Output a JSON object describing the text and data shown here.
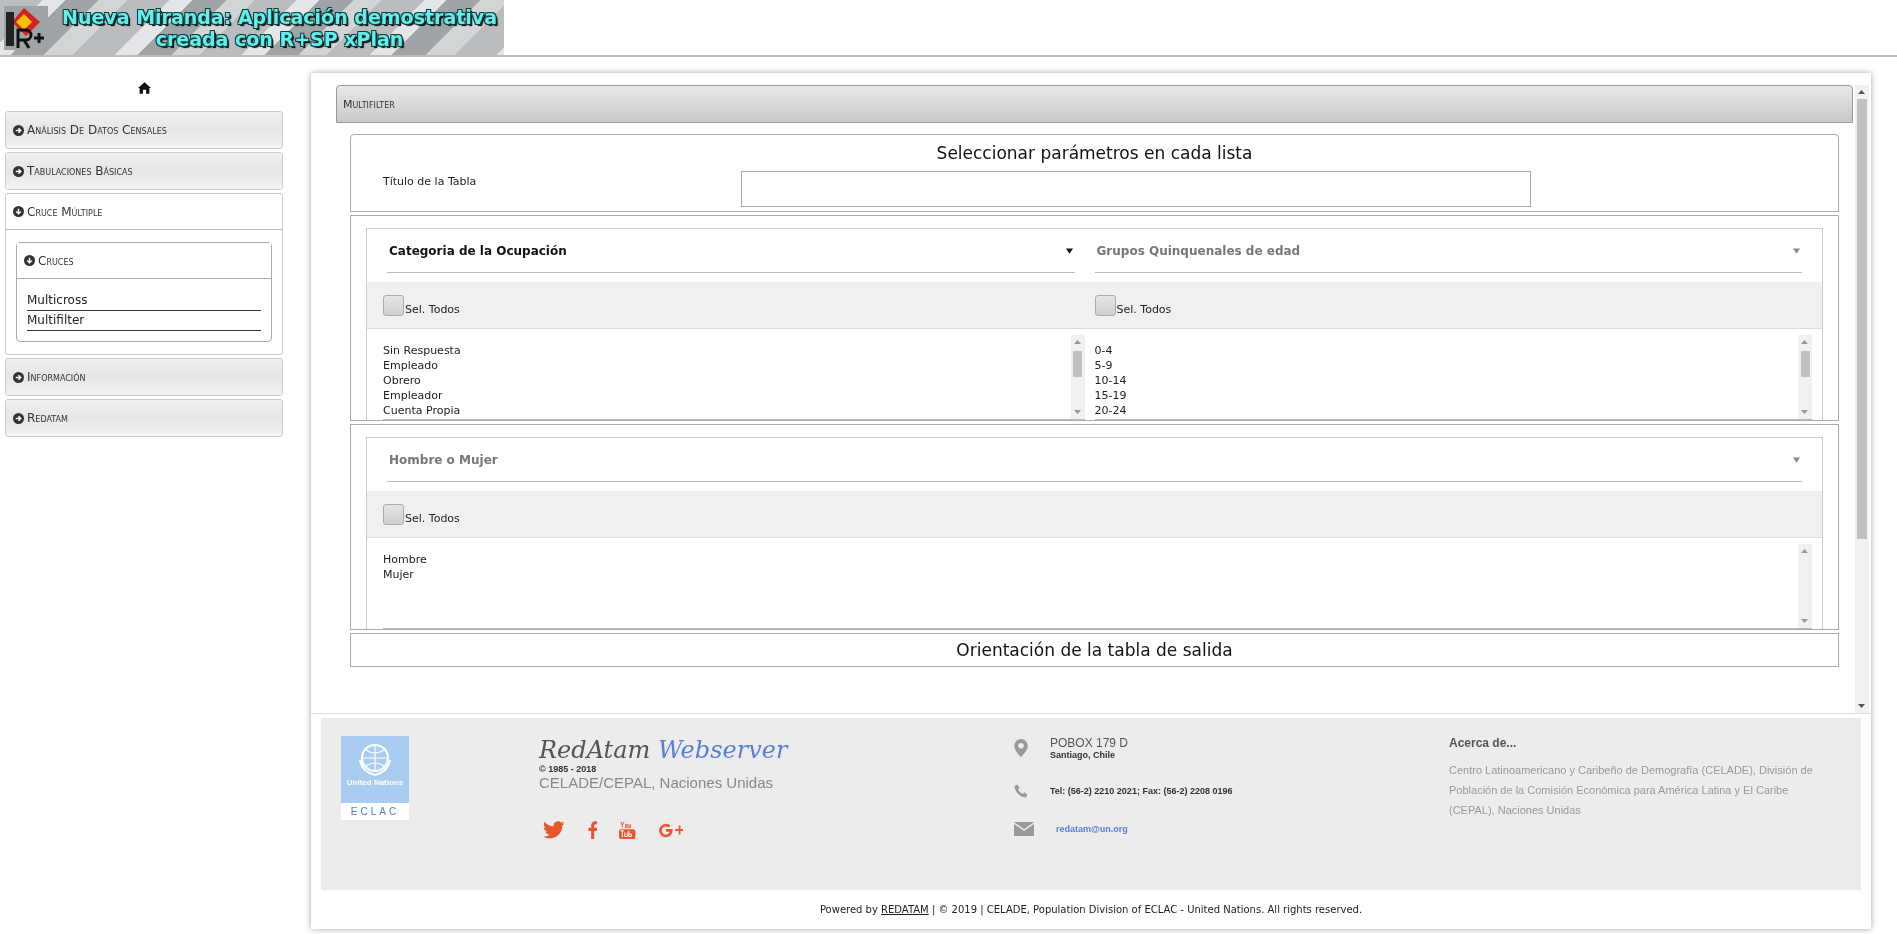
{
  "header": {
    "title_lines": [
      "Nueva Miranda: Aplicación demostrativa",
      "creada con R+SP xPlan"
    ]
  },
  "sidebar": {
    "items": [
      {
        "label": "Análisis De Datos Censales",
        "expanded": false
      },
      {
        "label": "Tabulaciones Básicas",
        "expanded": false
      },
      {
        "label": "Cruce Múltiple",
        "expanded": true,
        "children": [
          {
            "label": "Cruces",
            "expanded": true,
            "links": [
              "Multicross",
              "Multifilter"
            ]
          }
        ]
      },
      {
        "label": "Información",
        "expanded": false
      },
      {
        "label": "Redatam",
        "expanded": false
      }
    ]
  },
  "panel": {
    "title": "Multifilter",
    "heading": "Seleccionar parámetros en cada lista",
    "table_title_label": "Título de la Tabla",
    "filter_rows": [
      [
        {
          "variable": "Categoria de la Ocupación",
          "active": true,
          "select_all": "Sel. Todos",
          "checked": false,
          "options": [
            "Sin Respuesta",
            "Empleado",
            "Obrero",
            "Empleador",
            "Cuenta Propia"
          ]
        },
        {
          "variable": "Grupos Quinquenales de edad",
          "active": false,
          "select_all": "Sel. Todos",
          "checked": false,
          "options": [
            "0-4",
            "5-9",
            "10-14",
            "15-19",
            "20-24"
          ]
        }
      ],
      [
        {
          "variable": "Hombre o Mujer",
          "active": false,
          "select_all": "Sel. Todos",
          "checked": false,
          "options": [
            "Hombre",
            "Mujer"
          ]
        }
      ]
    ],
    "next_heading": "Orientación de la tabla de salida"
  },
  "footer": {
    "logo_lines": [
      "United Nations",
      "ECLAC"
    ],
    "brand": [
      "RedAtam",
      "Webserver"
    ],
    "years": "© 1985 - 2018",
    "org": "CELADE/CEPAL, Naciones Unidas",
    "address": "POBOX 179 D",
    "city": "Santiago, Chile",
    "phone": "Tel: (56-2) 2210 2021; Fax: (56-2) 2208 0196",
    "email": "redatam@un.org",
    "about_title": "Acerca de...",
    "about_text": "Centro Latinoamericano y Caribeño de Demografía (CELADE), División de Población de la Comisión Económica para América Latina y El Caribe (CEPAL), Naciones Unidas",
    "copyright": {
      "before": "Powered by",
      "link": "REDATAM",
      "after": "| © 2019 | CELADE, Population Division of ECLAC - United Nations. All rights reserved."
    }
  }
}
